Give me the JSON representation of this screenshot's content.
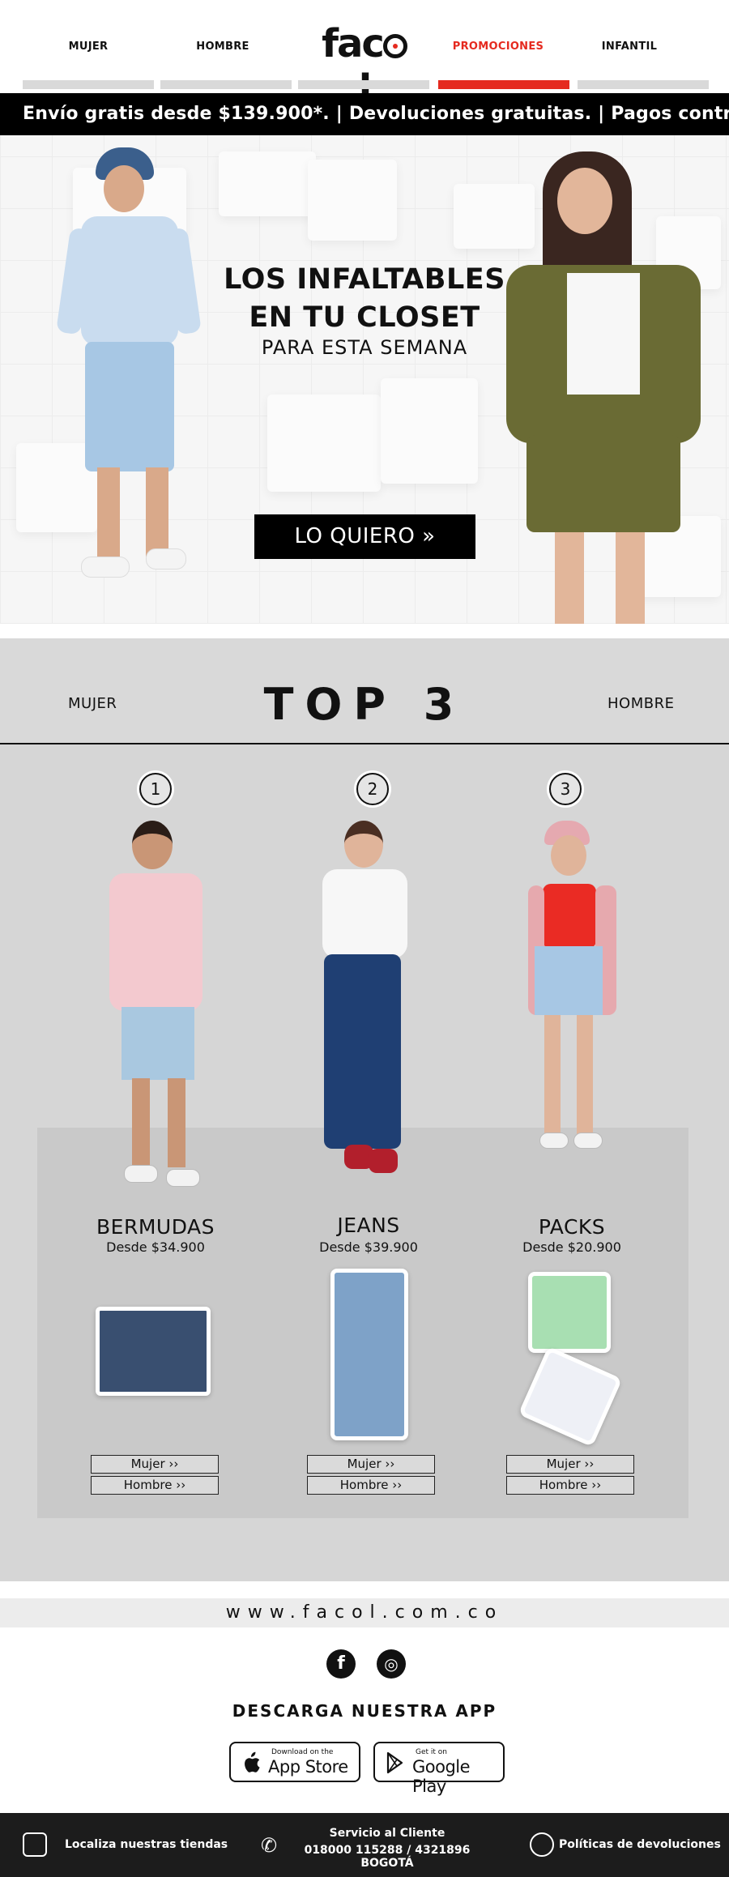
{
  "nav": {
    "items": [
      {
        "label": "MUJER"
      },
      {
        "label": "HOMBRE"
      },
      {
        "label": "PROMOCIONES"
      },
      {
        "label": "INFANTIL"
      }
    ],
    "logo_text": "fac",
    "logo_tail": "l",
    "active_color": "#e52a1f"
  },
  "marquee": {
    "text": "Envío gratis desde $139.900*.  |  Devoluciones gratuitas.  |  Pagos contra entrega.  Envío gra"
  },
  "hero": {
    "title_line1": "LOS INFALTABLES",
    "title_line2": "EN TU CLOSET",
    "subtitle": "PARA ESTA SEMANA",
    "cta": "LO QUIERO »"
  },
  "top3": {
    "left_label": "MUJER",
    "title": "TOP 3",
    "right_label": "HOMBRE",
    "products": [
      {
        "rank": "1",
        "name": "BERMUDAS",
        "price": "Desde $34.900",
        "btn_mujer": "Mujer ››",
        "btn_hombre": "Hombre ››"
      },
      {
        "rank": "2",
        "name": "JEANS",
        "price": "Desde $39.900",
        "btn_mujer": "Mujer ››",
        "btn_hombre": "Hombre ››"
      },
      {
        "rank": "3",
        "name": "PACKS",
        "price": "Desde $20.900",
        "btn_mujer": "Mujer ››",
        "btn_hombre": "Hombre ››"
      }
    ]
  },
  "footer": {
    "url": "www.facol.com.co",
    "social": [
      {
        "icon": "facebook-icon",
        "glyph": "f"
      },
      {
        "icon": "instagram-icon",
        "glyph": "◎"
      }
    ],
    "app_title": "DESCARGA NUESTRA APP",
    "app_store": {
      "small": "Download on the",
      "big": "App Store"
    },
    "google_play": {
      "small": "Get it on",
      "big": "Google Play"
    },
    "bottom": {
      "stores": "Localiza nuestras tiendas",
      "service_title": "Servicio al Cliente",
      "service_phone": "018000 115288 / 4321896 BOGOTÁ",
      "returns": "Políticas de devoluciones"
    }
  }
}
